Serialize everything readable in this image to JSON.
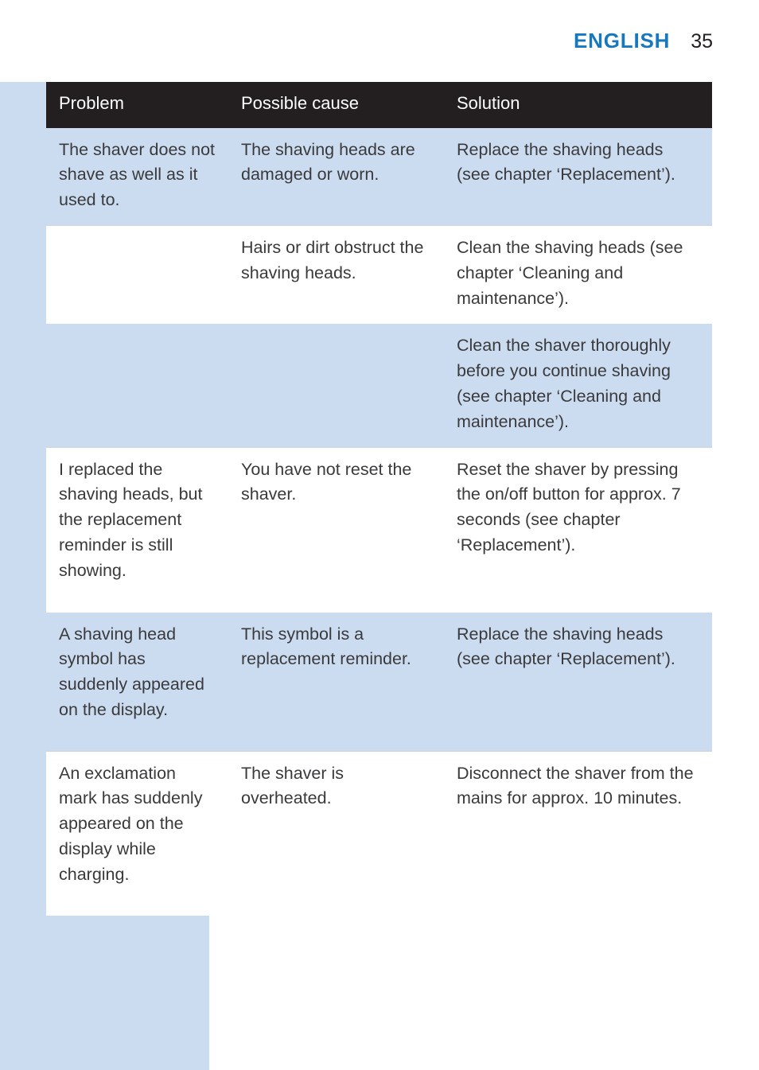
{
  "header": {
    "language": "ENGLISH",
    "page_number": "35"
  },
  "table": {
    "columns": [
      "Problem",
      "Possible cause",
      "Solution"
    ],
    "rows": [
      {
        "band": "band-blue",
        "problem": "The shaver does not shave as well as it used to.",
        "cause": "The shaving heads are damaged or worn.",
        "solution": "Replace the shaving heads (see chapter ‘Replacement’)."
      },
      {
        "band": "band-white",
        "problem": "",
        "cause": "Hairs or dirt obstruct the shaving heads.",
        "solution": "Clean the shaving heads (see chapter ‘Cleaning and maintenance’)."
      },
      {
        "band": "band-blue",
        "problem": "",
        "cause": "",
        "solution": "Clean the shaver thoroughly before you continue shaving (see chapter ‘Cleaning and maintenance’)."
      },
      {
        "band": "band-white",
        "problem": "I replaced the shaving heads, but the replacement reminder is still showing.",
        "cause": "You have not reset the shaver.",
        "solution": "Reset the shaver by pressing the on/off button for approx. 7 seconds (see chapter ‘Replacement’)."
      },
      {
        "band": "band-blue",
        "problem": "A shaving head symbol has suddenly appeared on the display.",
        "cause": "This symbol is a replacement reminder.",
        "solution": "Replace the shaving heads (see chapter ‘Replacement’)."
      },
      {
        "band": "band-white",
        "problem": "An exclamation mark has suddenly appeared on the display while charging.",
        "cause": "The shaver is overheated.",
        "solution": "Disconnect the shaver from the mains for approx. 10 minutes."
      }
    ],
    "row_heights": [
      "112px",
      "112px",
      "143px",
      "207px",
      "175px",
      "207px"
    ]
  },
  "colors": {
    "accent_blue": "#1878be",
    "band_blue": "#ccdcf0",
    "header_black": "#231f20",
    "body_text": "#3a3a3c"
  }
}
